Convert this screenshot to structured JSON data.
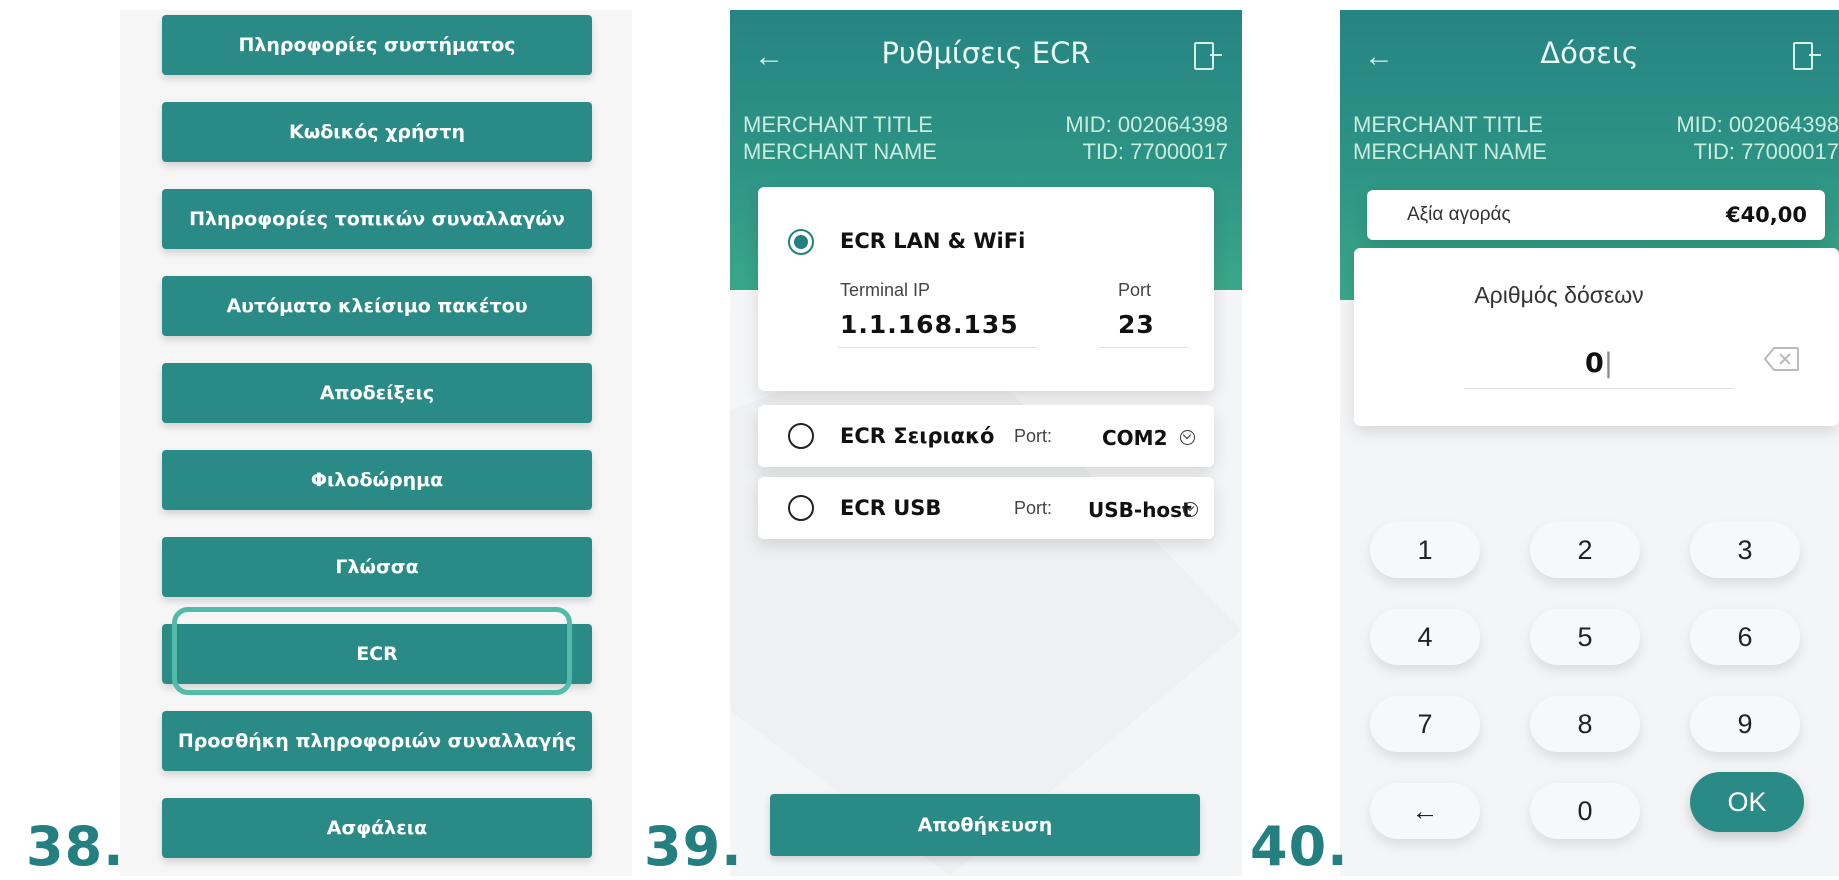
{
  "steps": [
    "38.",
    "39.",
    "40."
  ],
  "panel1": {
    "menu": [
      "Πληροφορίες συστήματος",
      "Κωδικός χρήστη",
      "Πληροφορίες τοπικών συναλλαγών",
      "Αυτόματο κλείσιμο πακέτου",
      "Αποδείξεις",
      "Φιλοδώρημα",
      "Γλώσσα",
      "ECR",
      "Προσθήκη πληροφοριών συναλλαγής",
      "Ασφάλεια"
    ],
    "highlighted": "ECR"
  },
  "panel2": {
    "title": "Ρυθμίσεις ECR",
    "merchant_title": "MERCHANT TITLE",
    "merchant_name": "MERCHANT NAME",
    "mid": "MID: 002064398",
    "tid": "TID: 77000017",
    "lan": {
      "label": "ECR LAN & WiFi",
      "ip_label": "Terminal IP",
      "ip_value": "1.1.168.135",
      "port_label": "Port",
      "port_value": "23",
      "selected": true
    },
    "serial": {
      "label": "ECR Σειριακό",
      "port_label": "Port:",
      "port_value": "COM2",
      "selected": false
    },
    "usb": {
      "label": "ECR USB",
      "port_label": "Port:",
      "port_value": "USB-host",
      "selected": false
    },
    "save_label": "Αποθήκευση"
  },
  "panel3": {
    "title": "Δόσεις",
    "merchant_title": "MERCHANT TITLE",
    "merchant_name": "MERCHANT NAME",
    "mid": "MID: 002064398",
    "tid": "TID: 77000017",
    "amount_label": "Αξία αγοράς",
    "amount_value": "€40,00",
    "installments_label": "Αριθμός δόσεων",
    "installments_value": "0",
    "keys": [
      "1",
      "2",
      "3",
      "4",
      "5",
      "6",
      "7",
      "8",
      "9",
      "←",
      "0",
      "OK"
    ]
  },
  "colors": {
    "accent": "#2a8a86",
    "highlight": "#52bba9",
    "step_number": "#237f80"
  }
}
